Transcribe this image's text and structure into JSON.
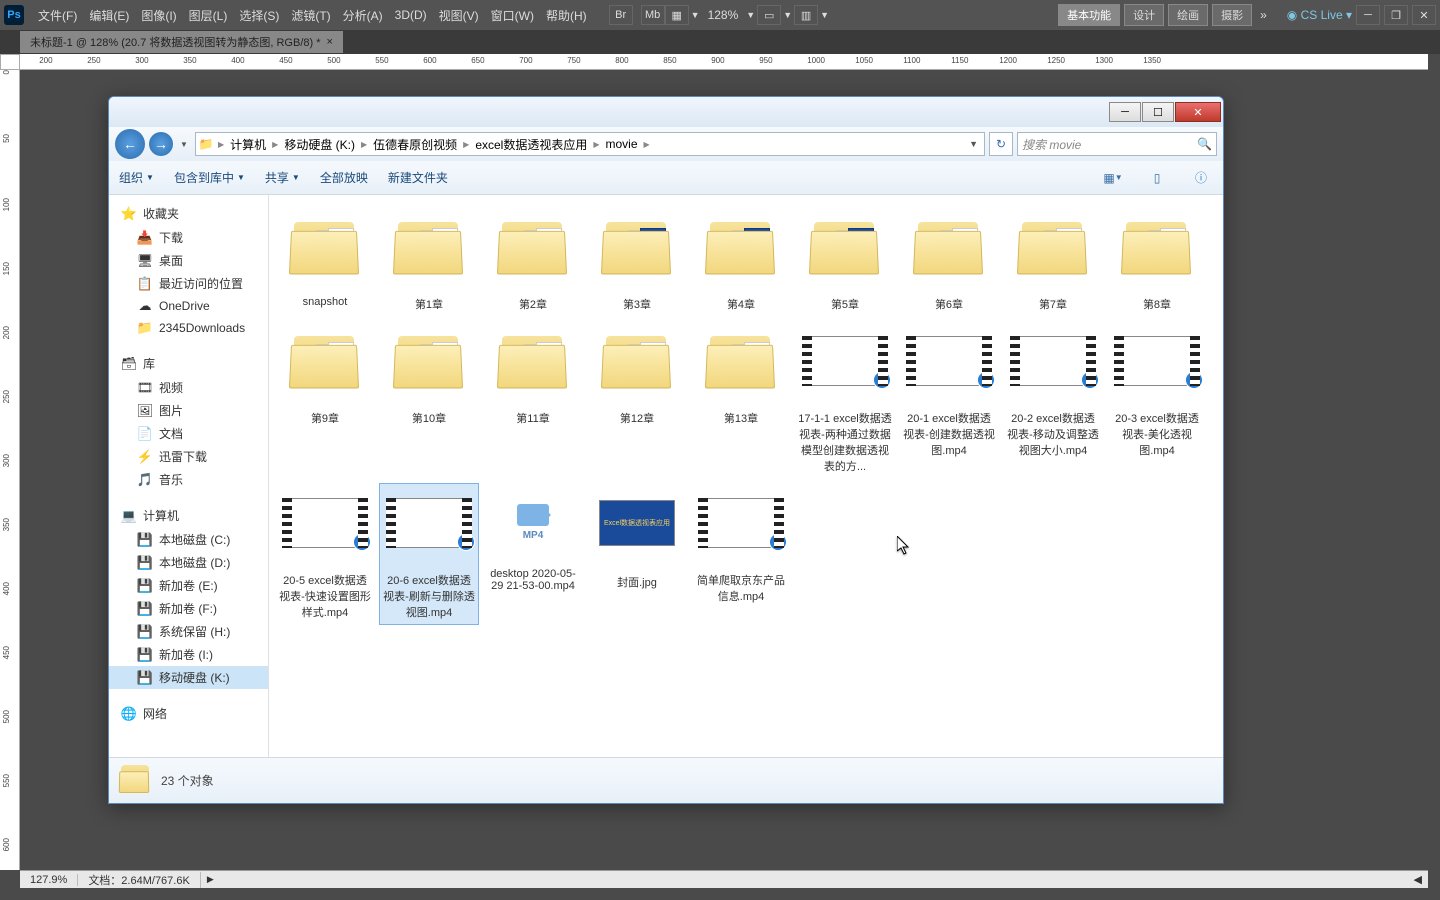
{
  "ps": {
    "menu": [
      "文件(F)",
      "编辑(E)",
      "图像(I)",
      "图层(L)",
      "选择(S)",
      "滤镜(T)",
      "分析(A)",
      "3D(D)",
      "视图(V)",
      "窗口(W)",
      "帮助(H)"
    ],
    "zoom": "128%",
    "workspaces": [
      "基本功能",
      "设计",
      "绘画",
      "摄影"
    ],
    "cslive": "CS Live",
    "tab": "未标题-1 @ 128% (20.7 将数据透视图转为静态图, RGB/8) *",
    "status_zoom": "127.9%",
    "status_doc": "文档：2.64M/767.6K"
  },
  "explorer": {
    "breadcrumb": [
      "计算机",
      "移动硬盘 (K:)",
      "伍德春原创视频",
      "excel数据透视表应用",
      "movie"
    ],
    "search_placeholder": "搜索 movie",
    "toolbar": {
      "org": "组织",
      "lib": "包含到库中",
      "share": "共享",
      "play": "全部放映",
      "newfolder": "新建文件夹"
    },
    "sidebar": {
      "fav": {
        "title": "收藏夹",
        "items": [
          "下载",
          "桌面",
          "最近访问的位置",
          "OneDrive",
          "2345Downloads"
        ]
      },
      "lib": {
        "title": "库",
        "items": [
          "视频",
          "图片",
          "文档",
          "迅雷下载",
          "音乐"
        ]
      },
      "comp": {
        "title": "计算机",
        "items": [
          "本地磁盘 (C:)",
          "本地磁盘 (D:)",
          "新加卷 (E:)",
          "新加卷 (F:)",
          "系统保留 (H:)",
          "新加卷 (I:)",
          "移动硬盘 (K:)"
        ]
      },
      "net": {
        "title": "网络"
      }
    },
    "folders_r1": [
      "snapshot",
      "第1章",
      "第2章",
      "第3章",
      "第4章",
      "第5章",
      "第6章",
      "第7章",
      "第8章"
    ],
    "folders_r2": [
      "第9章",
      "第10章",
      "第11章",
      "第12章",
      "第13章"
    ],
    "videos_r2": [
      "17-1-1 excel数据透视表-两种通过数据模型创建数据透视表的方...",
      "20-1 excel数据透视表-创建数据透视图.mp4",
      "20-2 excel数据透视表-移动及调整透视图大小.mp4",
      "20-3 excel数据透视表-美化透视图.mp4"
    ],
    "row3": {
      "v1": "20-5 excel数据透视表-快速设置图形样式.mp4",
      "v2": "20-6 excel数据透视表-刷新与删除透视图.mp4",
      "mp4name": "desktop 2020-05-29 21-53-00.mp4",
      "mp4tag": "MP4",
      "img": "封面.jpg",
      "v3": "简单爬取京东产品信息.mp4"
    },
    "status": "23 个对象"
  }
}
